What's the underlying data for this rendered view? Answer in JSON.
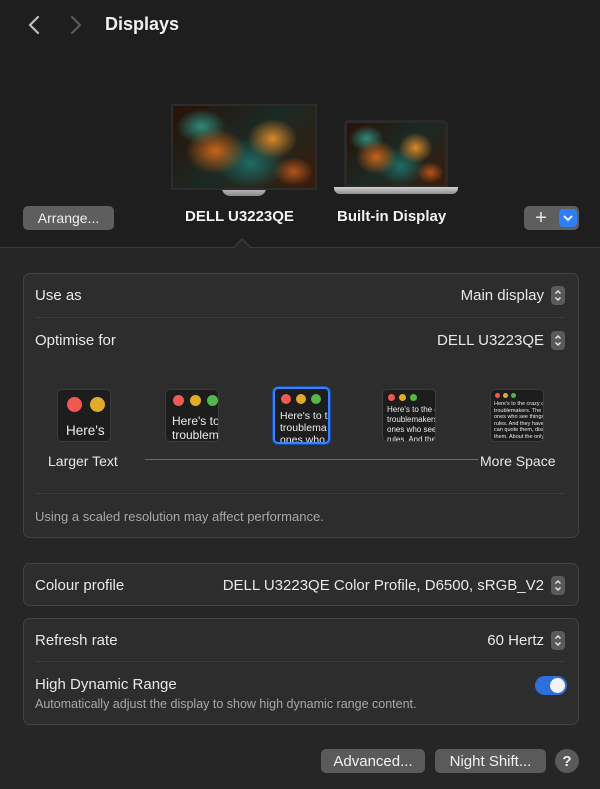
{
  "header": {
    "title": "Displays",
    "back_icon": "chevron-left-icon",
    "forward_icon": "chevron-right-icon"
  },
  "displays": {
    "arrange_label": "Arrange...",
    "items": [
      {
        "name": "DELL U3223QE",
        "selected": true
      },
      {
        "name": "Built-in Display",
        "selected": false
      }
    ],
    "add_icon": "plus-icon"
  },
  "settings": {
    "use_as": {
      "label": "Use as",
      "value": "Main display"
    },
    "optimise_for": {
      "label": "Optimise for",
      "value": "DELL U3223QE"
    },
    "resolution": {
      "left_label": "Larger Text",
      "right_label": "More Space",
      "selected_index": 2,
      "option_count": 5,
      "options": [
        {
          "text": "Here's"
        },
        {
          "text": "Here's to\ntroublem"
        },
        {
          "text": "Here's to t\ntroublema\nones who"
        },
        {
          "text": "Here's to the cr\ntroublemakers,\nones who see t\nrules. And they"
        },
        {
          "text": "Here's to the crazy ones\ntroublemakers. The roun\nones who see things diff\nrules. And they have no\ncan quote them, disagre\nthem. About the only thi\nBecause they change th"
        }
      ]
    },
    "footnote": "Using a scaled resolution may affect performance.",
    "colour_profile": {
      "label": "Colour profile",
      "value": "DELL U3223QE Color Profile, D6500, sRGB_V2"
    },
    "refresh_rate": {
      "label": "Refresh rate",
      "value": "60 Hertz"
    },
    "hdr": {
      "label": "High Dynamic Range",
      "description": "Automatically adjust the display to show high dynamic range content.",
      "enabled": true
    }
  },
  "buttons": {
    "advanced": "Advanced...",
    "night_shift": "Night Shift...",
    "help": "?"
  },
  "colors": {
    "accent": "#2f7ef4",
    "traffic_red": "#ee5a52",
    "traffic_yellow": "#e0ac28",
    "traffic_green": "#53b848"
  }
}
